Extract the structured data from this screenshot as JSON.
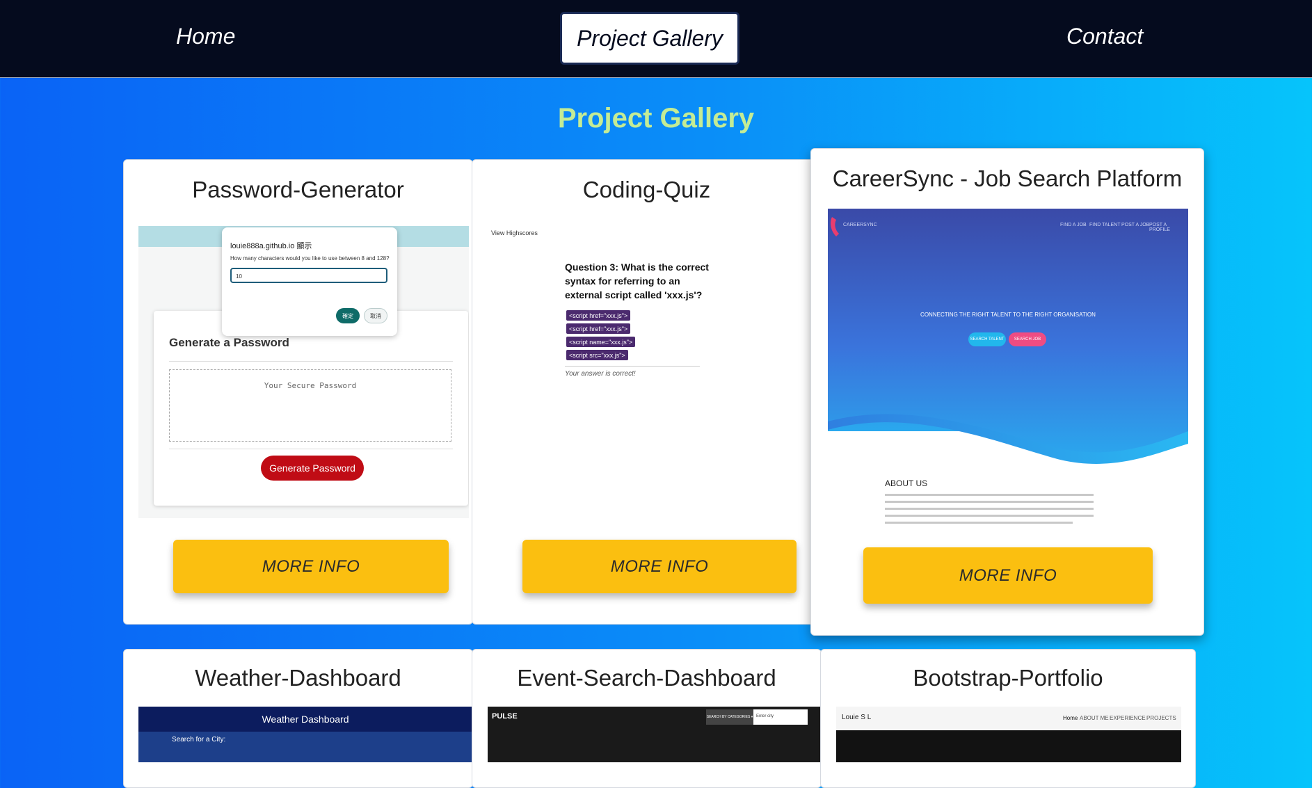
{
  "nav": {
    "home": "Home",
    "project_gallery": "Project Gallery",
    "contact": "Contact"
  },
  "page_title": "Project Gallery",
  "projects": [
    {
      "title": "Password-Generator",
      "more_info": "MORE INFO",
      "preview": {
        "dialog_title": "louie888a.github.io 顯示",
        "dialog_prompt": "How many characters would you like to use between 8 and 128?",
        "dialog_value": "10",
        "dialog_ok": "確定",
        "dialog_cancel": "取消",
        "heading": "Generate a Password",
        "output_placeholder": "Your Secure Password",
        "button": "Generate Password"
      }
    },
    {
      "title": "Coding-Quiz",
      "more_info": "MORE INFO",
      "preview": {
        "highscores": "View Highscores",
        "question": "Question 3: What is the correct syntax for referring to an external script called 'xxx.js'?",
        "answers": [
          "<script href=\"xxx.js\">",
          "<script href=\"xxx.js\">",
          "<script name=\"xxx.js\">",
          "<script src=\"xxx.js\">"
        ],
        "result": "Your answer is correct!"
      }
    },
    {
      "title": "CareerSync - Job Search Platform",
      "more_info": "MORE INFO",
      "preview": {
        "brand": "CAREERSYNC",
        "nav": [
          "FIND A JOB",
          "FIND TALENT",
          "POST A JOB",
          "POST A PROFILE"
        ],
        "tagline": "CONNECTING THE RIGHT TALENT TO THE RIGHT ORGANISATION",
        "btn_talent": "SEARCH TALENT",
        "btn_job": "SEARCH JOB",
        "about": "ABOUT US"
      }
    },
    {
      "title": "Weather-Dashboard",
      "preview": {
        "header": "Weather Dashboard",
        "search_label": "Search for a City:"
      }
    },
    {
      "title": "Event-Search-Dashboard",
      "preview": {
        "logo": "PULSE",
        "categories": "SEARCH BY CATEGORIES ▾",
        "input_placeholder": "Enter city"
      }
    },
    {
      "title": "Bootstrap-Portfolio",
      "preview": {
        "name": "Louie S L",
        "nav": [
          "Home",
          "ABOUT ME",
          "EXPERIENCE",
          "PROJECTS"
        ]
      }
    }
  ],
  "colors": {
    "nav_bg": "#050b1e",
    "title": "#c4ec95",
    "button": "#fbbf10",
    "bg_left": "#0a63f6",
    "bg_right": "#06c4fb"
  }
}
